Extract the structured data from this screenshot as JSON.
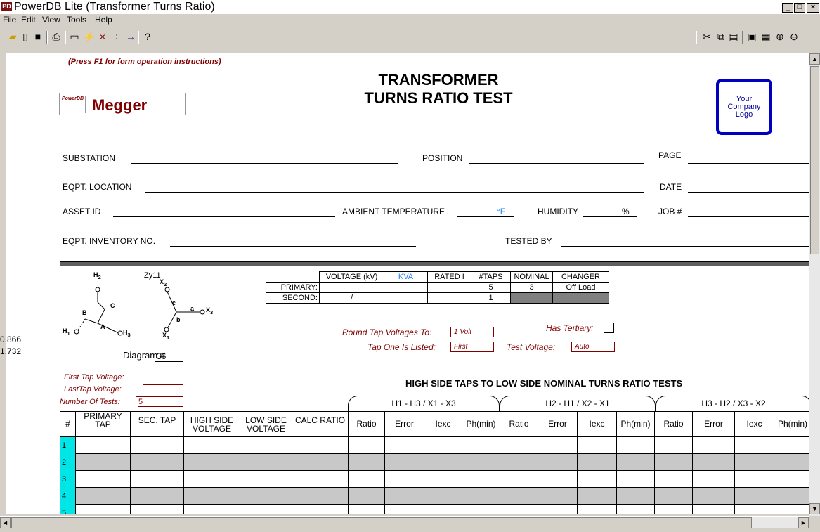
{
  "window": {
    "title": "PowerDB Lite (Transformer Turns Ratio)",
    "app_icon": "PowerDB-icon",
    "controls": [
      "_",
      "□",
      "×"
    ]
  },
  "menu": [
    "File",
    "Edit",
    "View",
    "Tools",
    "Help"
  ],
  "form": {
    "instructions": "(Press F1 for form operation instructions)",
    "title_line1": "TRANSFORMER",
    "title_line2": "TURNS RATIO TEST",
    "brand_logo": "PowerDB",
    "brand": "Megger",
    "company_logo": "Your Company Logo",
    "fields": {
      "substation": "SUBSTATION",
      "position": "POSITION",
      "page": "PAGE",
      "eqpt_location": "EQPT. LOCATION",
      "date": "DATE",
      "asset_id": "ASSET ID",
      "ambient": "AMBIENT TEMPERATURE",
      "temp_unit": "°F",
      "humidity": "HUMIDITY",
      "humidity_unit": "%",
      "job": "JOB #",
      "inventory": "EQPT. INVENTORY NO.",
      "tested_by": "TESTED BY"
    },
    "left_values": [
      "0.866",
      "1.732"
    ],
    "diagram": {
      "vector": "Zy11",
      "label": "Diagram #",
      "number": "36",
      "h1": "H",
      "h2": "H",
      "h3": "H",
      "x1": "X",
      "x2": "X",
      "x3": "X",
      "a": "a",
      "b": "b",
      "c": "c",
      "A": "A",
      "B": "B",
      "C": "C",
      "h1_sub": "1",
      "h2_sub": "2",
      "h3_sub": "3",
      "x1_sub": "1",
      "x2_sub": "2",
      "x3_sub": "3"
    },
    "rating_table": {
      "headers": [
        "VOLTAGE (kV)",
        "KVA",
        "RATED I",
        "#TAPS",
        "NOMINAL",
        "CHANGER"
      ],
      "rows": [
        {
          "label": "PRIMARY:",
          "values": [
            "",
            "",
            "",
            "5",
            "3",
            "Off Load"
          ]
        },
        {
          "label": "SECOND:",
          "values": [
            "/",
            "",
            "",
            "1",
            "",
            ""
          ]
        }
      ]
    },
    "options": {
      "round_label": "Round Tap Voltages To:",
      "round_value": "1 Volt",
      "tap_one_label": "Tap One Is Listed:",
      "tap_one_value": "First",
      "tertiary_label": "Has Tertiary:",
      "test_voltage_label": "Test Voltage:",
      "test_voltage_value": "Auto"
    },
    "taps": {
      "first_tap": "First Tap Voltage:",
      "last_tap": "LastTap Voltage:",
      "num_tests": "Number Of Tests:",
      "num_tests_value": "5"
    },
    "section_title": "HIGH SIDE TAPS TO LOW SIDE NOMINAL TURNS RATIO TESTS",
    "groups": [
      "H1 - H3 / X1 - X3",
      "H2 - H1 / X2 - X1",
      "H3 - H2 / X3 - X2"
    ],
    "columns": [
      "#",
      "PRIMARY TAP",
      "SEC. TAP",
      "HIGH SIDE VOLTAGE",
      "LOW SIDE VOLTAGE",
      "CALC RATIO",
      "Ratio",
      "Error",
      "Iexc",
      "Ph(min)",
      "Ratio",
      "Error",
      "Iexc",
      "Ph(min)",
      "Ratio",
      "Error",
      "Iexc",
      "Ph(min)"
    ],
    "rows": [
      "1",
      "2",
      "3",
      "4",
      "5"
    ]
  }
}
